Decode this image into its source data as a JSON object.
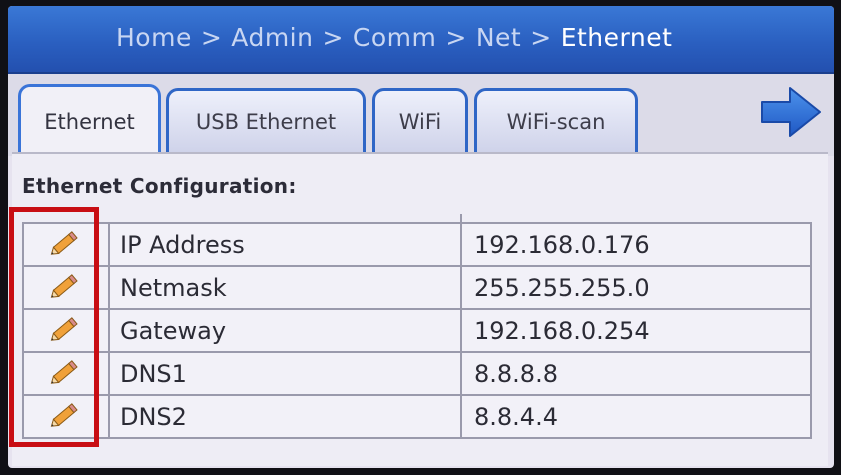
{
  "breadcrumb": {
    "items": [
      "Home",
      "Admin",
      "Comm",
      "Net"
    ],
    "current": "Ethernet",
    "separator": ">"
  },
  "tabs": [
    {
      "label": "Ethernet",
      "active": true
    },
    {
      "label": "USB Ethernet",
      "active": false
    },
    {
      "label": "WiFi",
      "active": false
    },
    {
      "label": "WiFi-scan",
      "active": false
    }
  ],
  "next_icon": "arrow-right-icon",
  "section_title": "Ethernet Configuration:",
  "rows": [
    {
      "name": "IP Address",
      "value": "192.168.0.176",
      "icon": "pencil-icon"
    },
    {
      "name": "Netmask",
      "value": "255.255.255.0",
      "icon": "pencil-icon"
    },
    {
      "name": "Gateway",
      "value": "192.168.0.254",
      "icon": "pencil-icon"
    },
    {
      "name": "DNS1",
      "value": "8.8.8.8",
      "icon": "pencil-icon"
    },
    {
      "name": "DNS2",
      "value": "8.8.4.4",
      "icon": "pencil-icon"
    }
  ],
  "colors": {
    "titlebar": "#2a5fc0",
    "tab_border": "#2f66c6",
    "highlight": "#c80e14",
    "pencil_body": "#f0a13a"
  }
}
